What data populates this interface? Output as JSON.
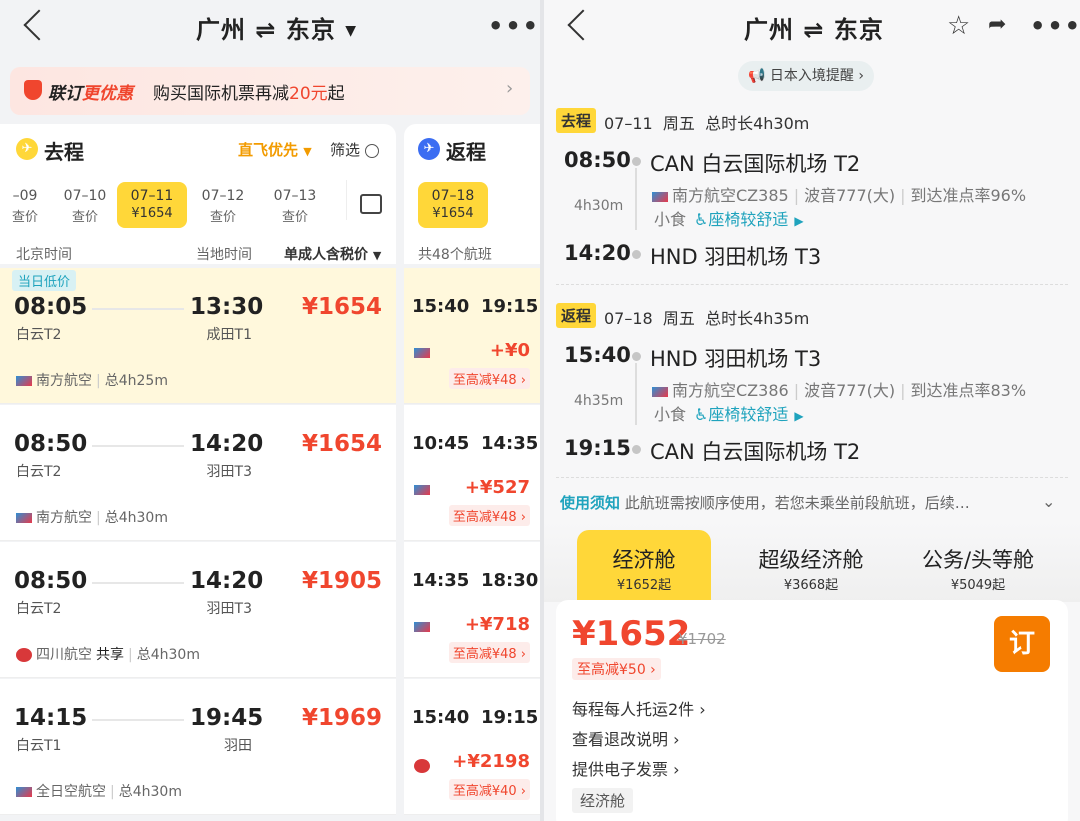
{
  "left": {
    "header_title": "广州 ⇌ 东京",
    "promo": {
      "brand_a": "联订",
      "brand_b": "更优惠",
      "text_a": "购买国际机票再减",
      "text_amount": "20元",
      "text_b": "起"
    },
    "out_label": "去程",
    "sort_label": "直飞优先",
    "filter_label": "筛选",
    "dates": [
      {
        "d": "–09",
        "p": "查价"
      },
      {
        "d": "07–10",
        "p": "查价"
      },
      {
        "d": "07–11",
        "p": "¥1654"
      },
      {
        "d": "07–12",
        "p": "查价"
      },
      {
        "d": "07–13",
        "p": "查价"
      }
    ],
    "col_beijing": "北京时间",
    "col_local": "当地时间",
    "col_price": "单成人含税价",
    "lowest_badge": "当日低价",
    "flights": [
      {
        "dep": "08:05",
        "dep_ap": "白云T2",
        "arr": "13:30",
        "arr_ap": "成田T1",
        "price": "¥1654",
        "airline": "南方航空",
        "share": "",
        "dur": "总4h25m"
      },
      {
        "dep": "08:50",
        "dep_ap": "白云T2",
        "arr": "14:20",
        "arr_ap": "羽田T3",
        "price": "¥1654",
        "airline": "南方航空",
        "share": "",
        "dur": "总4h30m"
      },
      {
        "dep": "08:50",
        "dep_ap": "白云T2",
        "arr": "14:20",
        "arr_ap": "羽田T3",
        "price": "¥1905",
        "airline": "四川航空",
        "share": "共享",
        "dur": "总4h30m"
      },
      {
        "dep": "14:15",
        "dep_ap": "白云T1",
        "arr": "19:45",
        "arr_ap": "羽田",
        "price": "¥1969",
        "airline": "全日空航空",
        "share": "",
        "dur": "总4h30m"
      }
    ]
  },
  "ret": {
    "label": "返程",
    "date_d": "07–18",
    "date_p": "¥1654",
    "count": "共48个航班",
    "flights": [
      {
        "dep": "15:40",
        "arr": "19:15",
        "add": "+¥0",
        "cut": "至高减¥48"
      },
      {
        "dep": "10:45",
        "arr": "14:35",
        "add": "+¥527",
        "cut": "至高减¥48"
      },
      {
        "dep": "14:35",
        "arr": "18:30",
        "add": "+¥718",
        "cut": "至高减¥48"
      },
      {
        "dep": "15:40",
        "arr": "19:15",
        "add": "+¥2198",
        "cut": "至高减¥40"
      }
    ]
  },
  "right": {
    "header_title": "广州 ⇌ 东京",
    "notice": "日本入境提醒",
    "out": {
      "tag": "去程",
      "info": "07–11  周五  总时长4h30m",
      "dep_time": "08:50",
      "dep_ap": "CAN 白云国际机场 T2",
      "dur": "4h30m",
      "flight": "南方航空CZ385",
      "plane": "波音777(大)",
      "ontime": "到达准点率96%",
      "meal": "小食",
      "comfort": "座椅较舒适",
      "arr_time": "14:20",
      "arr_ap": "HND 羽田机场 T3"
    },
    "back": {
      "tag": "返程",
      "info": "07–18  周五  总时长4h35m",
      "dep_time": "15:40",
      "dep_ap": "HND 羽田机场 T3",
      "dur": "4h35m",
      "flight": "南方航空CZ386",
      "plane": "波音777(大)",
      "ontime": "到达准点率83%",
      "meal": "小食",
      "comfort": "座椅较舒适",
      "arr_time": "19:15",
      "arr_ap": "CAN 白云国际机场 T2"
    },
    "rules_title": "使用须知",
    "rules_text": "此航班需按顺序使用，若您未乘坐前段航班，后续…",
    "cabins": [
      {
        "name": "经济舱",
        "price": "¥1652起"
      },
      {
        "name": "超级经济舱",
        "price": "¥3668起"
      },
      {
        "name": "公务/头等舱",
        "price": "¥5049起"
      }
    ],
    "offer": {
      "price": "¥1652",
      "orig": "¥1702",
      "cut": "至高减¥50",
      "book": "订",
      "bag": "每程每人托运2件",
      "refund": "查看退改说明",
      "invoice": "提供电子发票",
      "cabin": "经济舱"
    }
  },
  "colors": {
    "accent_yellow": "#ffd739",
    "price_red": "#f0462e",
    "book_orange": "#f57c00",
    "teal": "#1fa3bd"
  }
}
